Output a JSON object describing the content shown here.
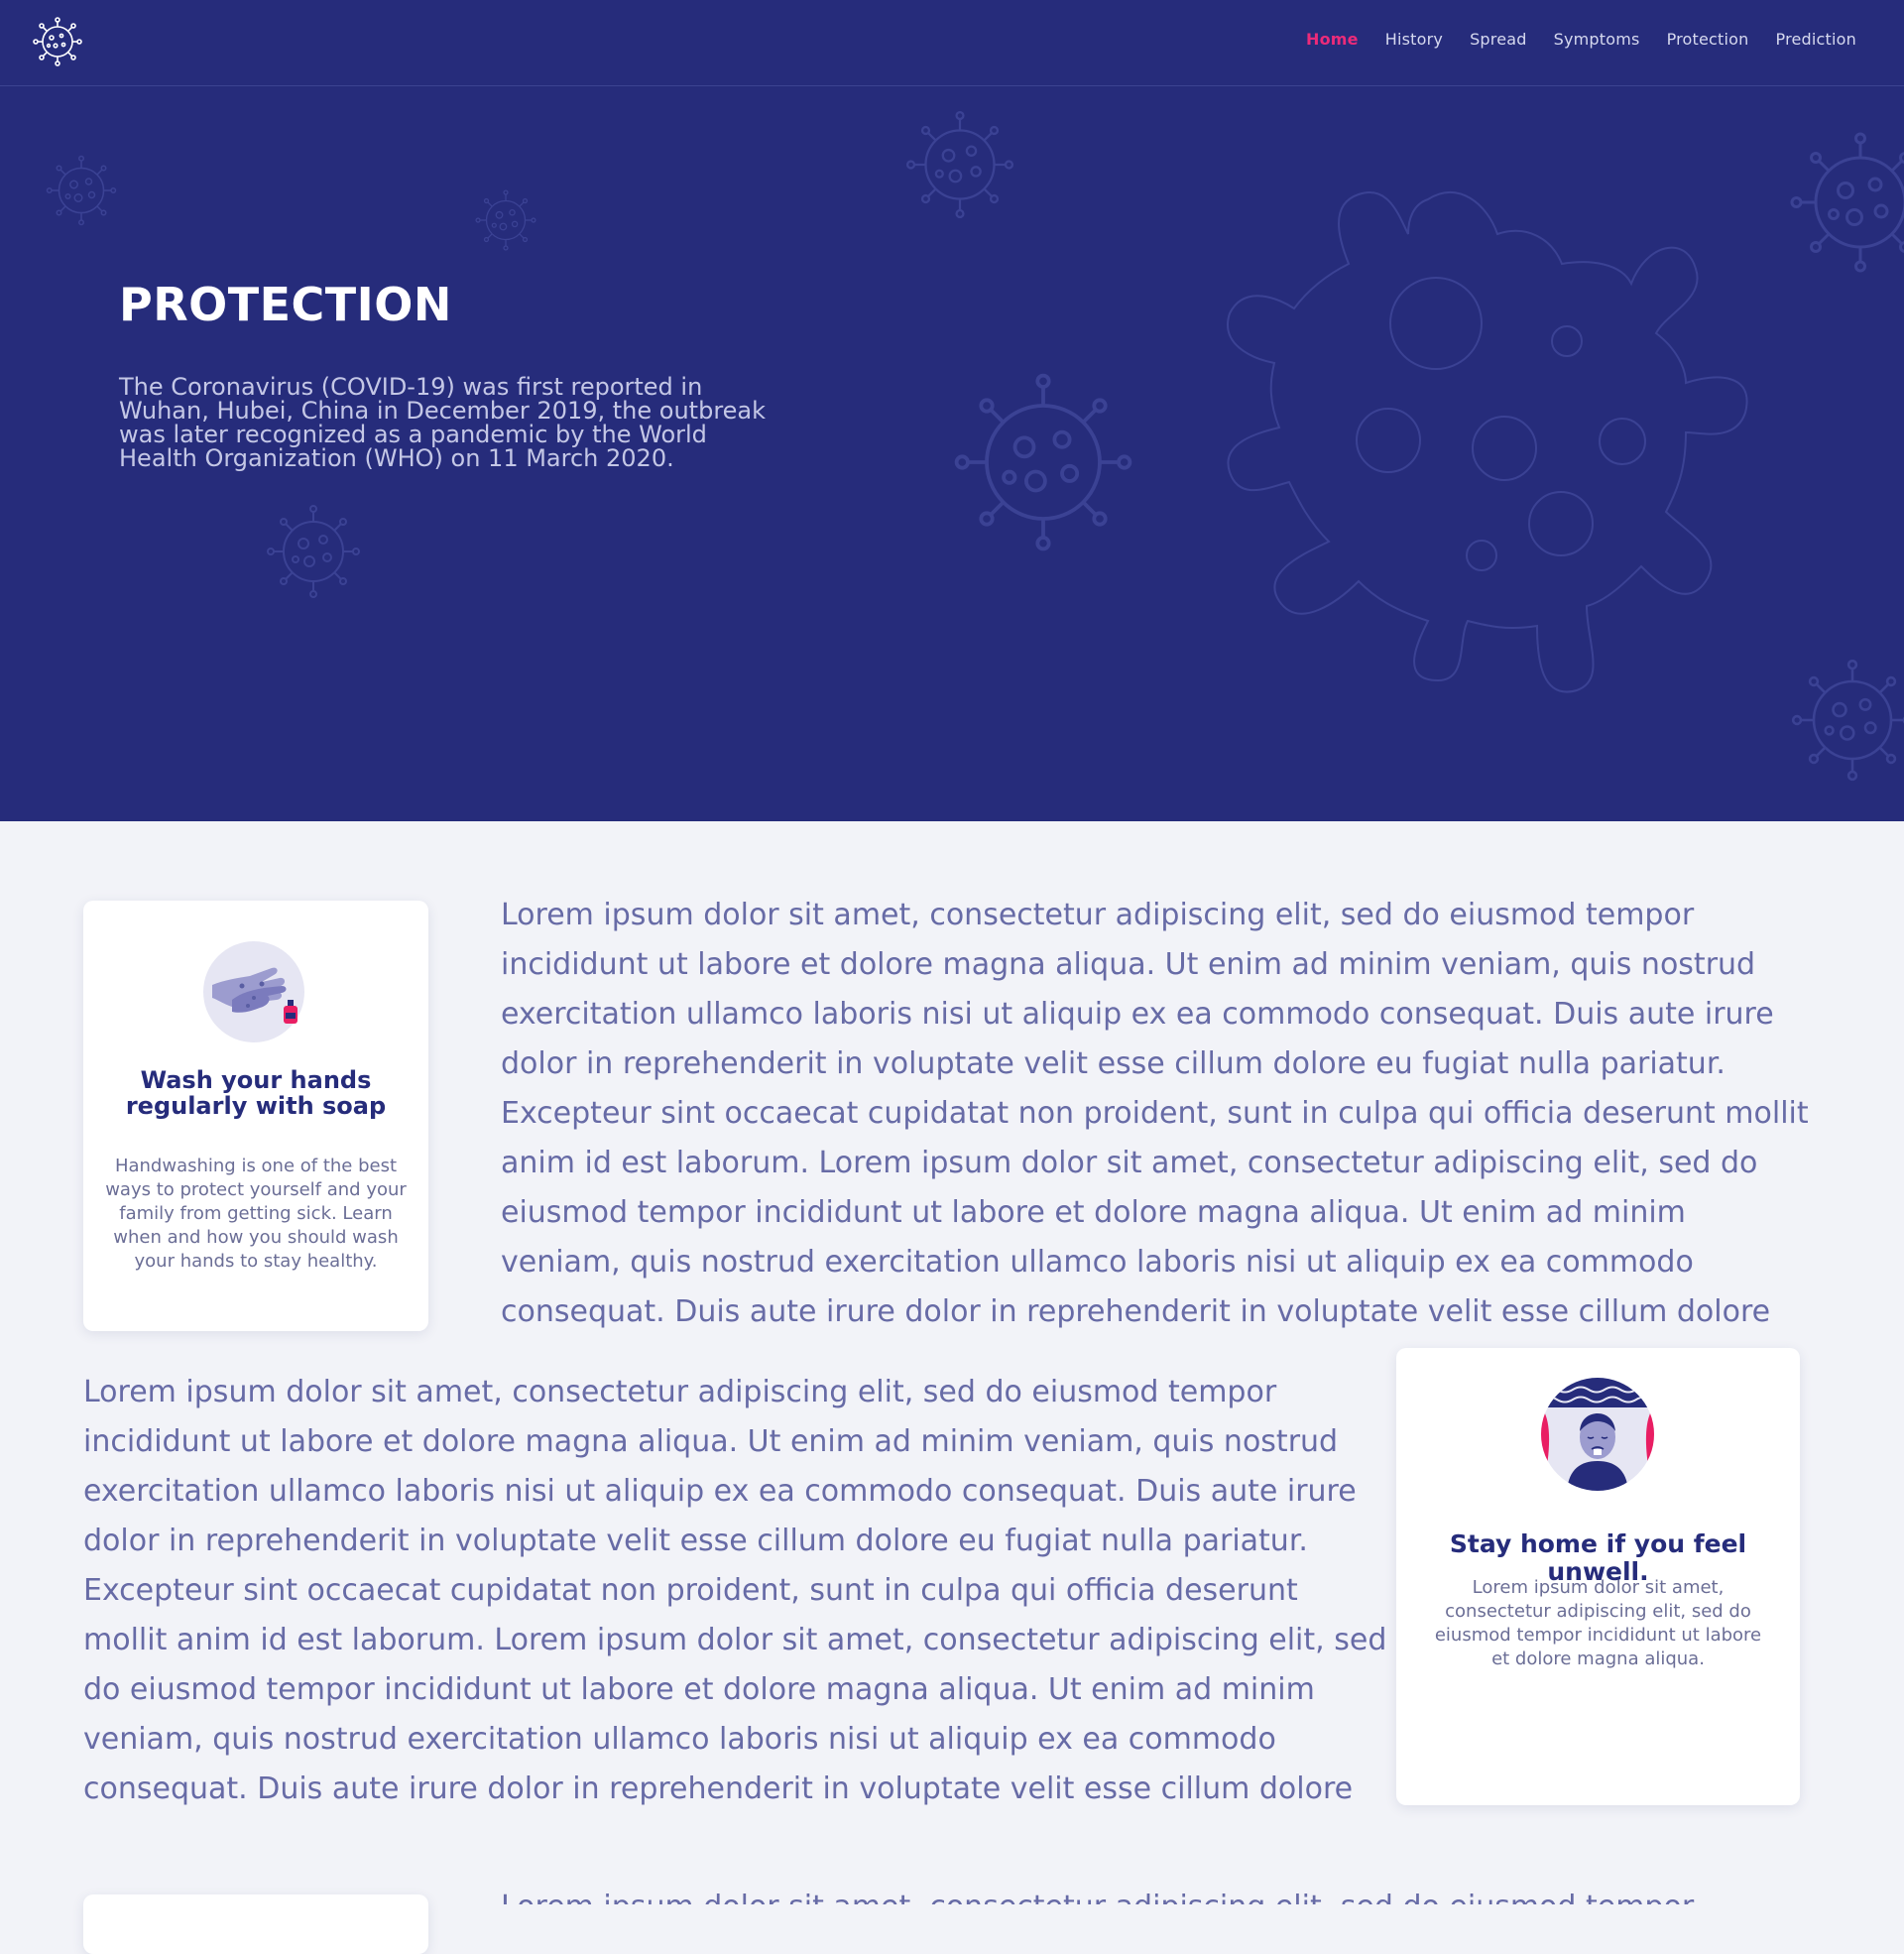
{
  "nav": {
    "logo": "virus-logo",
    "items": [
      {
        "label": "Home",
        "active": true
      },
      {
        "label": "History",
        "active": false
      },
      {
        "label": "Spread",
        "active": false
      },
      {
        "label": "Symptoms",
        "active": false
      },
      {
        "label": "Protection",
        "active": false
      },
      {
        "label": "Prediction",
        "active": false
      }
    ]
  },
  "hero": {
    "title": "PROTECTION",
    "text": "The Coronavirus (COVID-19) was first reported in Wuhan, Hubei, China in December 2019, the outbreak was later recognized as a pandemic by the World Health Organization (WHO) on 11 March 2020."
  },
  "cards": [
    {
      "title": "Wash your hands regularly with soap",
      "text": "Handwashing is one of the best ways to protect yourself and your family from getting sick. Learn when and how you should wash your hands to stay healthy.",
      "icon": "hand-washing-icon"
    },
    {
      "title": "Stay home if you feel unwell.",
      "text": "Lorem ipsum dolor sit amet, consectetur adipiscing elit, sed do eiusmod tempor incididunt ut labore et dolore magna aliqua.",
      "icon": "sick-person-icon"
    }
  ],
  "paragraphs": [
    "Lorem ipsum dolor sit amet, consectetur adipiscing elit, sed do eiusmod tempor incididunt ut labore et dolore magna aliqua. Ut enim ad minim veniam, quis nostrud exercitation ullamco laboris nisi ut aliquip ex ea commodo consequat. Duis aute irure dolor in reprehenderit in voluptate velit esse cillum dolore eu fugiat nulla pariatur. Excepteur sint occaecat cupidatat non proident, sunt in culpa qui officia deserunt mollit anim id est laborum. Lorem ipsum dolor sit amet, consectetur adipiscing elit, sed do eiusmod tempor incididunt ut labore et dolore magna aliqua. Ut enim ad minim veniam, quis nostrud exercitation ullamco laboris nisi ut aliquip ex ea commodo consequat. Duis aute irure dolor in reprehenderit in voluptate velit esse cillum dolore",
    "Lorem ipsum dolor sit amet, consectetur adipiscing elit, sed do eiusmod tempor incididunt ut labore et dolore magna aliqua. Ut enim ad minim veniam, quis nostrud exercitation ullamco laboris nisi ut aliquip ex ea commodo consequat. Duis aute irure dolor in reprehenderit in voluptate velit esse cillum dolore eu fugiat nulla pariatur. Excepteur sint occaecat cupidatat non proident, sunt in culpa qui officia deserunt mollit anim id est laborum. Lorem ipsum dolor sit amet, consectetur adipiscing elit, sed do eiusmod tempor incididunt ut labore et dolore magna aliqua. Ut enim ad minim veniam, quis nostrud exercitation ullamco laboris nisi ut aliquip ex ea commodo consequat. Duis aute irure dolor in reprehenderit in voluptate velit esse cillum dolore",
    "Lorem ipsum dolor sit amet, consectetur adipiscing elit, sed do eiusmod tempor"
  ],
  "colors": {
    "navy": "#262c7b",
    "accent_pink": "#ec2b79",
    "body_text": "#676ba6",
    "page_bg": "#f2f3f8"
  }
}
